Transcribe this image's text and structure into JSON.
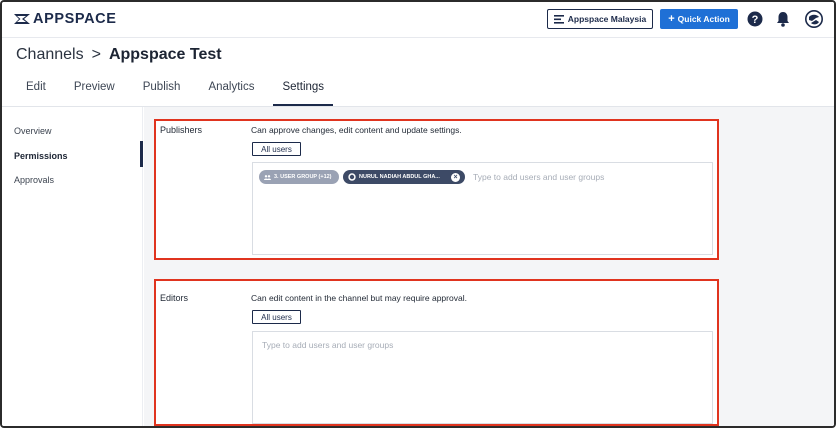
{
  "app": {
    "logo_text": "APPSPACE"
  },
  "topbar": {
    "org_label": "Appspace Malaysia",
    "quick_action_label": "Quick Action",
    "colors": {
      "primary": "#1f70d6",
      "navy": "#1c2a4a"
    },
    "icons": [
      "org-switch-icon",
      "plus-icon",
      "help-icon",
      "bell-icon",
      "user-avatar-icon"
    ]
  },
  "breadcrumb": {
    "parent": "Channels",
    "separator": ">",
    "current": "Appspace Test"
  },
  "tabs": [
    {
      "label": "Edit",
      "active": false
    },
    {
      "label": "Preview",
      "active": false
    },
    {
      "label": "Publish",
      "active": false
    },
    {
      "label": "Analytics",
      "active": false
    },
    {
      "label": "Settings",
      "active": true
    }
  ],
  "leftnav": {
    "items": [
      {
        "label": "Overview",
        "active": false
      },
      {
        "label": "Permissions",
        "active": true
      },
      {
        "label": "Approvals",
        "active": false
      }
    ]
  },
  "permissions": {
    "publishers": {
      "label": "Publishers",
      "description": "Can approve changes, edit content and update settings.",
      "all_users_label": "All users",
      "chips": [
        {
          "label": "3. USER GROUP (+12)",
          "type": "group"
        },
        {
          "label": "NURUL NADIAH ABDUL GHA...",
          "type": "user"
        }
      ],
      "placeholder": "Type to add users and user groups"
    },
    "editors": {
      "label": "Editors",
      "description": "Can edit content in the channel but may require approval.",
      "all_users_label": "All users",
      "placeholder": "Type to add users and user groups"
    },
    "highlight_color": "#e0341f"
  }
}
